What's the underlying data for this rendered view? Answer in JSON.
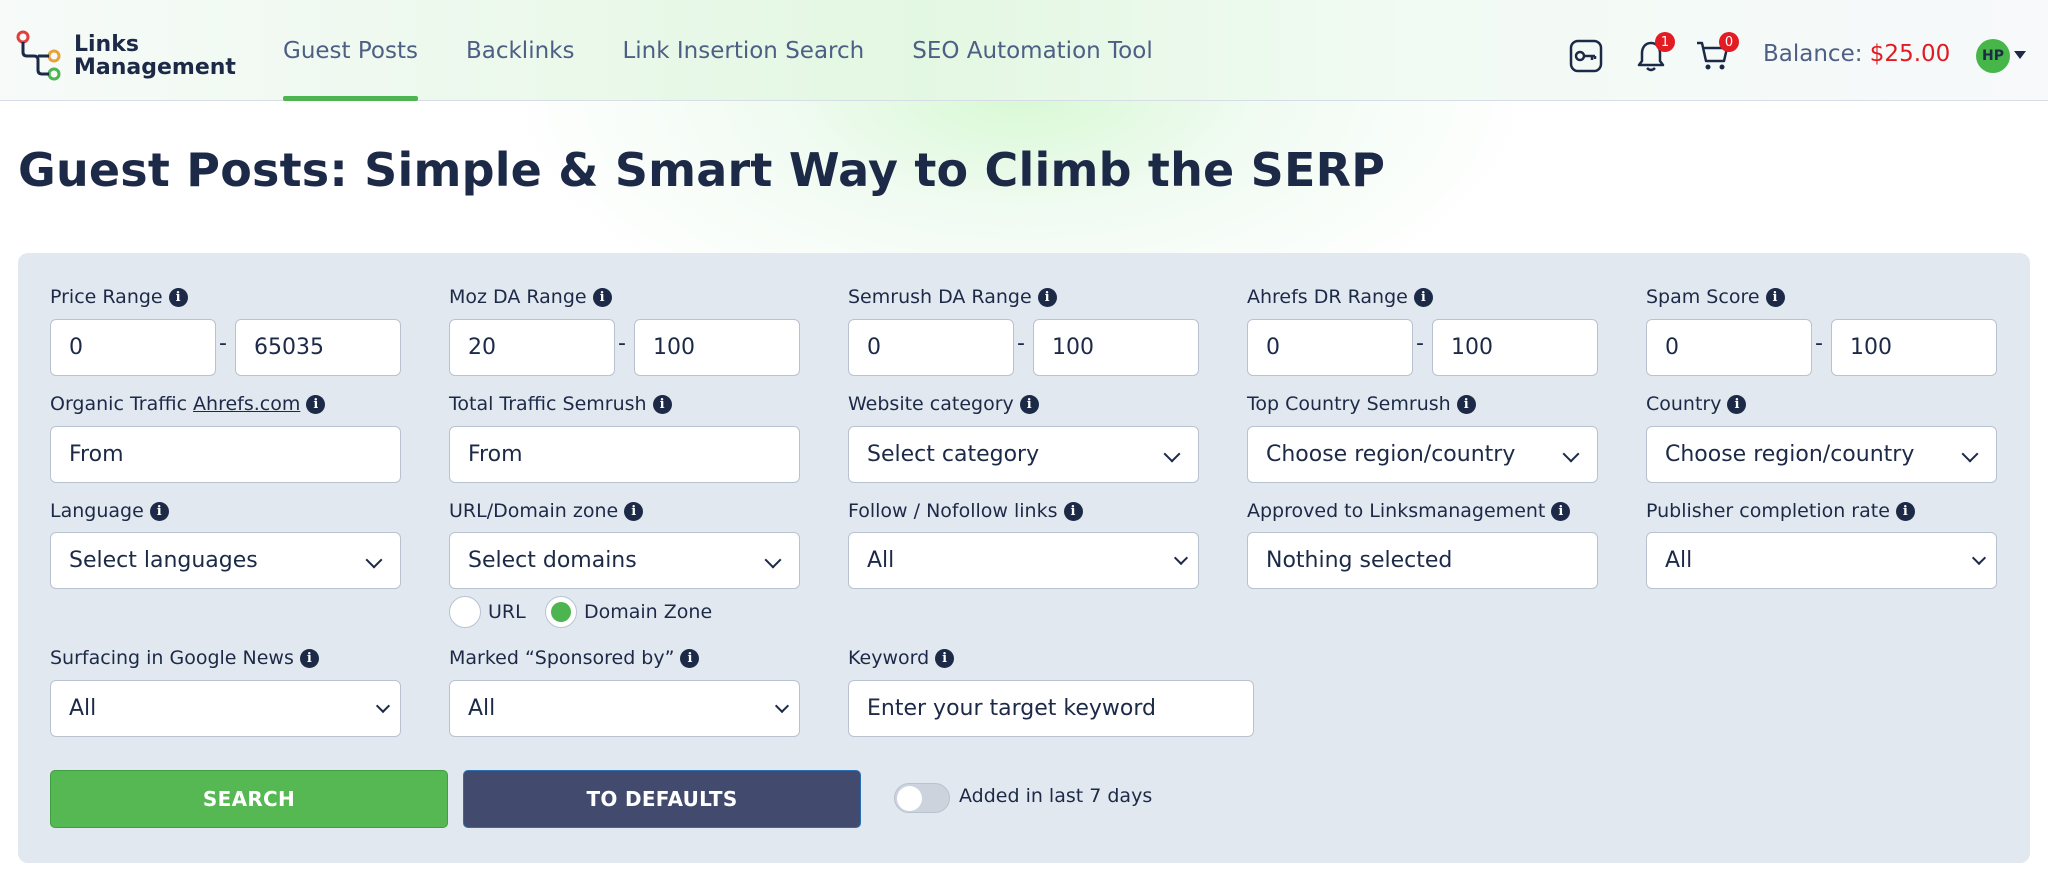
{
  "header": {
    "logo_line1": "Links",
    "logo_line2": "Management",
    "nav": [
      {
        "label": "Guest Posts",
        "active": true
      },
      {
        "label": "Backlinks"
      },
      {
        "label": "Link Insertion Search"
      },
      {
        "label": "SEO Automation Tool"
      }
    ],
    "notifications_count": "1",
    "cart_count": "0",
    "balance_label": "Balance:",
    "balance_amount": "$25.00",
    "avatar_initials": "HP"
  },
  "page_title": "Guest Posts: Simple & Smart Way to Climb the SERP",
  "filters": {
    "price_range": {
      "label": "Price Range",
      "min": "0",
      "max": "65035"
    },
    "moz_da": {
      "label": "Moz DA Range",
      "min": "20",
      "max": "100"
    },
    "semrush_da": {
      "label": "Semrush DA Range",
      "min": "0",
      "max": "100"
    },
    "ahrefs_dr": {
      "label": "Ahrefs DR Range",
      "min": "0",
      "max": "100"
    },
    "spam_score": {
      "label": "Spam Score",
      "min": "0",
      "max": "100"
    },
    "organic_traffic": {
      "label": "Organic Traffic",
      "link": "Ahrefs.com",
      "value": "From"
    },
    "total_traffic": {
      "label": "Total Traffic Semrush",
      "value": "From"
    },
    "website_category": {
      "label": "Website category",
      "value": "Select category"
    },
    "top_country": {
      "label": "Top Country Semrush",
      "value": "Choose region/country"
    },
    "country": {
      "label": "Country",
      "value": "Choose region/country"
    },
    "language": {
      "label": "Language",
      "value": "Select languages"
    },
    "url_domain_zone": {
      "label": "URL/Domain zone",
      "value": "Select domains",
      "radio_url": "URL",
      "radio_zone": "Domain Zone",
      "selected": "Domain Zone"
    },
    "follow": {
      "label": "Follow / Nofollow links",
      "value": "All"
    },
    "approved": {
      "label": "Approved to Linksmanagement",
      "value": "Nothing selected"
    },
    "completion_rate": {
      "label": "Publisher completion rate",
      "value": "All"
    },
    "google_news": {
      "label": "Surfacing in Google News",
      "value": "All"
    },
    "sponsored": {
      "label": "Marked “Sponsored by”",
      "value": "All"
    },
    "keyword": {
      "label": "Keyword",
      "placeholder": "Enter your target keyword"
    }
  },
  "actions": {
    "search": "SEARCH",
    "defaults": "TO DEFAULTS",
    "added_last_7_days": "Added in last 7 days",
    "added_last_7_days_on": false
  },
  "colors": {
    "accent_green": "#4cb54f",
    "navy": "#1c2a48",
    "badge_red": "#e31b23",
    "button_dark": "#424b6e"
  }
}
